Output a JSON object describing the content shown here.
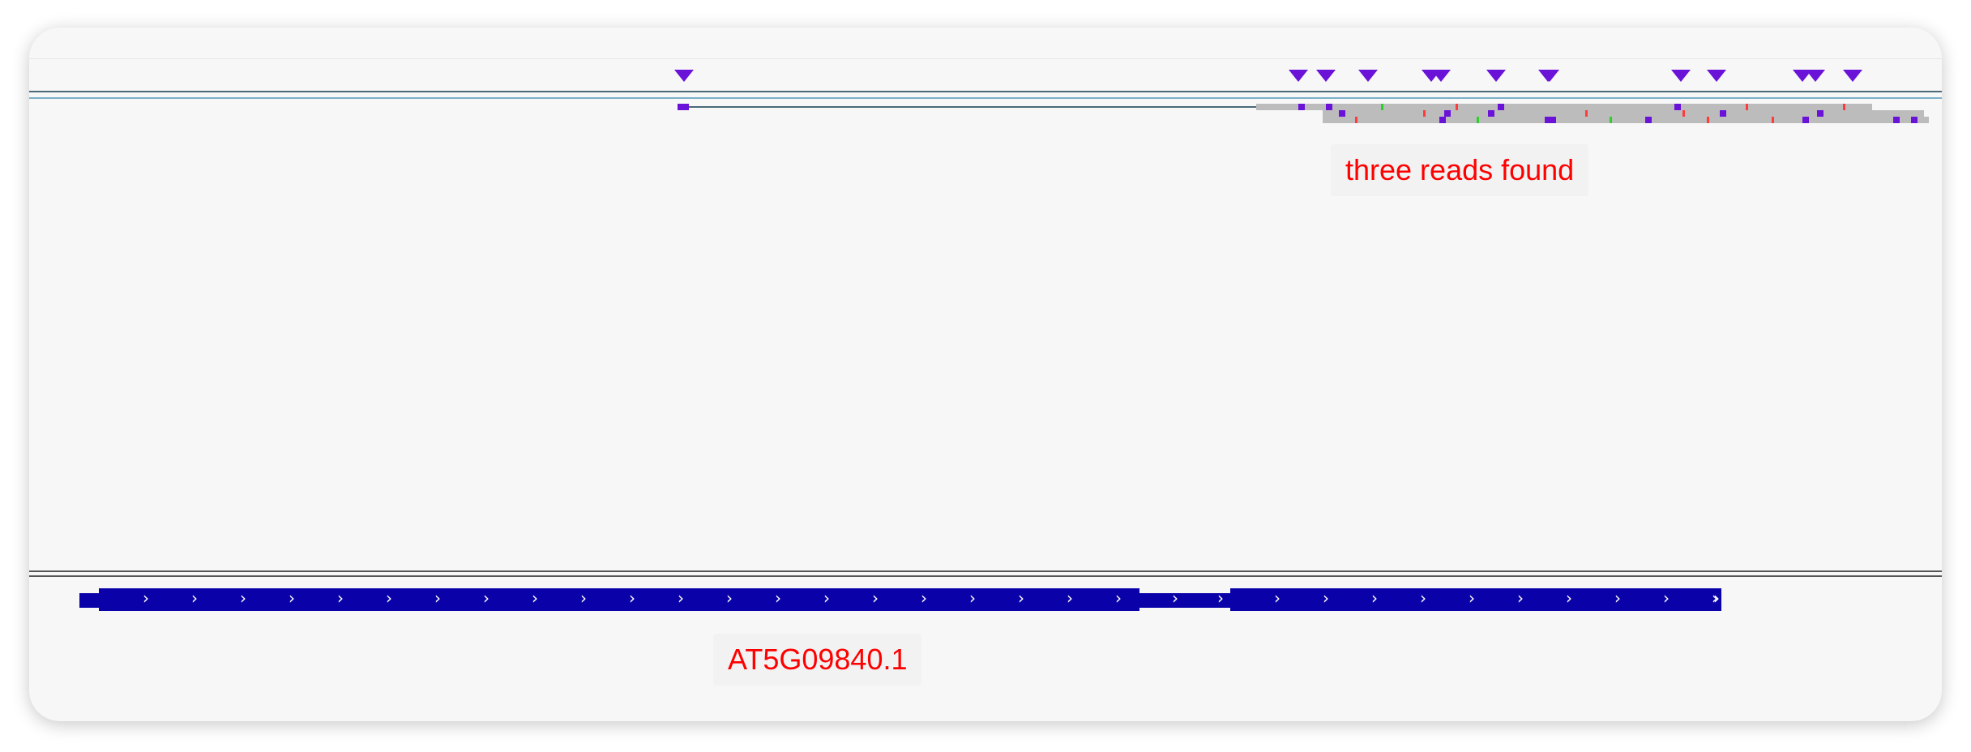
{
  "colors": {
    "marker": "#6a12d8",
    "read": "#bcbcbc",
    "gene": "#0a02a8",
    "annotation": "#ff0000"
  },
  "annotations": {
    "reads_label": "three reads found",
    "gene_label": "AT5G09840.1"
  },
  "gene_track": {
    "strand_glyph": "›",
    "name": "AT5G09840.1"
  },
  "icons": {
    "insertion_marker": "triangle-down-icon",
    "strand_chevron": "chevron-right-icon"
  }
}
